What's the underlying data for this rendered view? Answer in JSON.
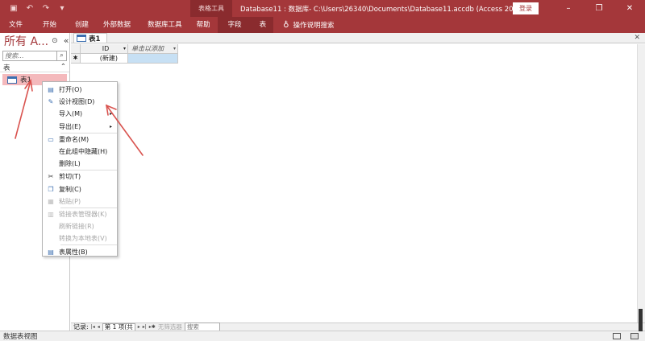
{
  "window": {
    "context_tab_label": "表格工具",
    "title": "Database11 : 数据库- C:\\Users\\26340\\Documents\\Database11.accdb (Access 2007 - 2016 文件格式) -...",
    "login_label": "登录",
    "controls": [
      "–",
      "❐",
      "✕"
    ]
  },
  "quick_access": {
    "icons": [
      "save-icon",
      "undo-icon",
      "redo-icon",
      "customize-icon"
    ]
  },
  "ribbon": {
    "tabs": [
      "文件",
      "开始",
      "创建",
      "外部数据",
      "数据库工具",
      "帮助",
      "字段",
      "表"
    ],
    "tell_me": "操作说明搜索"
  },
  "nav_pane": {
    "title": "所有 A...",
    "collapse": "«",
    "search_placeholder": "搜索...",
    "group_label": "表",
    "group_toggle": "⌃",
    "items": [
      {
        "label": "表1"
      }
    ]
  },
  "document": {
    "tab_label": "表1",
    "close": "✕",
    "columns": [
      {
        "header": "ID",
        "dropdown": "▾"
      },
      {
        "header": "单击以添加",
        "dropdown": "▾"
      }
    ],
    "new_row_marker": "✱",
    "new_row_value": "(新建)"
  },
  "record_nav": {
    "label": "记录:",
    "first": "|◂",
    "prev": "◂",
    "position": "第 1 项(共",
    "next": "▸",
    "last": "▸|",
    "new": "▸✱",
    "filter": "无筛选器",
    "search_placeholder": "搜索"
  },
  "status": {
    "text": "数据表视图"
  },
  "context_menu": {
    "items": [
      {
        "label": "打开(O)",
        "icon": "open-icon",
        "disabled": false
      },
      {
        "label": "设计视图(D)",
        "icon": "design-view-icon",
        "disabled": false
      },
      {
        "label": "导入(M)",
        "icon": "",
        "disabled": false,
        "submenu": true
      },
      {
        "label": "导出(E)",
        "icon": "",
        "disabled": false,
        "submenu": true
      },
      {
        "label": "重命名(M)",
        "icon": "rename-icon",
        "disabled": false
      },
      {
        "label": "在此组中隐藏(H)",
        "icon": "",
        "disabled": false
      },
      {
        "label": "删除(L)",
        "icon": "",
        "disabled": false
      },
      {
        "label": "剪切(T)",
        "icon": "cut-icon",
        "disabled": false
      },
      {
        "label": "复制(C)",
        "icon": "copy-icon",
        "disabled": false
      },
      {
        "label": "粘贴(P)",
        "icon": "paste-icon",
        "disabled": true
      },
      {
        "label": "链接表管理器(K)",
        "icon": "linked-table-manager-icon",
        "disabled": true
      },
      {
        "label": "刷新链接(R)",
        "icon": "",
        "disabled": true
      },
      {
        "label": "转换为本地表(V)",
        "icon": "",
        "disabled": true
      },
      {
        "label": "表属性(B)",
        "icon": "table-properties-icon",
        "disabled": false
      }
    ]
  },
  "colors": {
    "accent": "#a4373a",
    "annotation": "#d9534f",
    "selected_item": "#f4b9bc"
  }
}
